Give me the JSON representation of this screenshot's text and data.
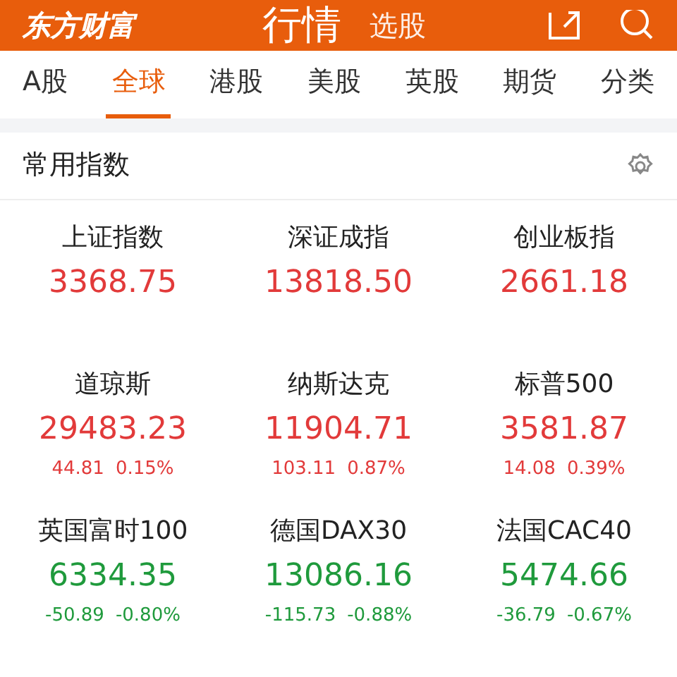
{
  "header": {
    "logo": "东方财富",
    "tabs": [
      {
        "label": "行情",
        "selected": true
      },
      {
        "label": "选股",
        "selected": false
      }
    ]
  },
  "market_tabs": [
    {
      "label": "A股",
      "selected": false
    },
    {
      "label": "全球",
      "selected": true
    },
    {
      "label": "港股",
      "selected": false
    },
    {
      "label": "美股",
      "selected": false
    },
    {
      "label": "英股",
      "selected": false
    },
    {
      "label": "期货",
      "selected": false
    },
    {
      "label": "分类",
      "selected": false
    }
  ],
  "section": {
    "title": "常用指数"
  },
  "indices": [
    {
      "name": "上证指数",
      "value": "3368.75",
      "kind": "up"
    },
    {
      "name": "深证成指",
      "value": "13818.50",
      "kind": "up"
    },
    {
      "name": "创业板指",
      "value": "2661.18",
      "kind": "up"
    },
    {
      "name": "道琼斯",
      "value": "29483.23",
      "change": "44.81",
      "percent": "0.15%",
      "kind": "up"
    },
    {
      "name": "纳斯达克",
      "value": "11904.71",
      "change": "103.11",
      "percent": "0.87%",
      "kind": "up"
    },
    {
      "name": "标普500",
      "value": "3581.87",
      "change": "14.08",
      "percent": "0.39%",
      "kind": "up"
    },
    {
      "name": "英国富时100",
      "value": "6334.35",
      "change": "-50.89",
      "percent": "-0.80%",
      "kind": "down"
    },
    {
      "name": "德国DAX30",
      "value": "13086.16",
      "change": "-115.73",
      "percent": "-0.88%",
      "kind": "down"
    },
    {
      "name": "法国CAC40",
      "value": "5474.66",
      "change": "-36.79",
      "percent": "-0.67%",
      "kind": "down"
    }
  ]
}
